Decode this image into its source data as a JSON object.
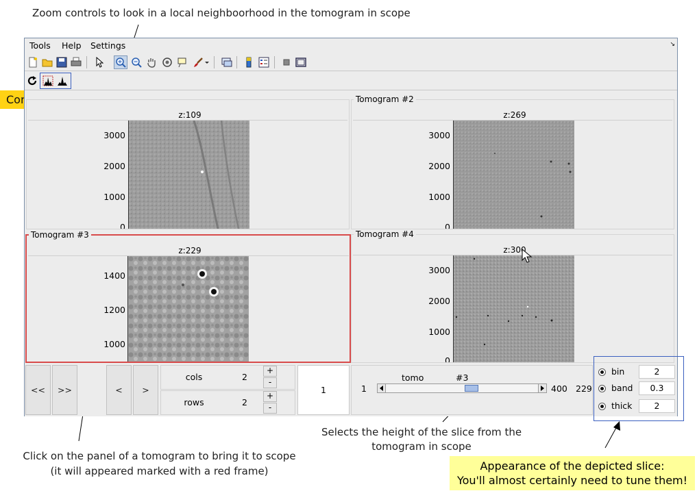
{
  "annotations": {
    "zoom_note": "Zoom controls to look in a local neighboorhood in  the tomogram in scope",
    "contrast_note": "Contrast controls",
    "panel_note_line1": "Click on the panel of a tomogram to bring it to scope",
    "panel_note_line2": "(it will appeared marked with a red frame)",
    "slice_note_line1": "Selects the height of the slice from the",
    "slice_note_line2": "tomogram in scope",
    "appearance_note_line1": "Appearance of the depicted slice:",
    "appearance_note_line2": "You'll almost certainly need to tune them!"
  },
  "menu": {
    "tools": "Tools",
    "help": "Help",
    "settings": "Settings"
  },
  "toolbar_icons": [
    "new-file-icon",
    "open-folder-icon",
    "save-icon",
    "print-icon",
    "pointer-icon",
    "zoom-in-icon",
    "zoom-out-icon",
    "pan-hand-icon",
    "rotate-3d-icon",
    "data-cursor-icon",
    "brush-icon",
    "dropdown-arrow-icon",
    "link-plot-icon",
    "colorbar-icon",
    "legend-icon",
    "hide-plot-tools-icon",
    "show-plot-tools-icon"
  ],
  "contrast_icons": [
    "refresh-icon",
    "contrast-auto-icon",
    "contrast-histogram-icon"
  ],
  "panels": [
    {
      "title": "",
      "z_label": "z:109",
      "ticks": [
        "3000",
        "2000",
        "1000",
        "0"
      ]
    },
    {
      "title": "Tomogram #2",
      "z_label": "z:269",
      "ticks": [
        "3000",
        "2000",
        "1000",
        "0"
      ]
    },
    {
      "title": "Tomogram #3",
      "z_label": "z:229",
      "ticks": [
        "1400",
        "1200",
        "1000"
      ],
      "selected": true
    },
    {
      "title": "Tomogram #4",
      "z_label": "z:300",
      "ticks": [
        "3000",
        "2000",
        "1000",
        "0"
      ]
    }
  ],
  "controls": {
    "first_label": "<<",
    "next_page_label": ">>",
    "prev_label": "<",
    "next_label": ">",
    "cols_label": "cols",
    "cols_value": "2",
    "rows_label": "rows",
    "rows_value": "2",
    "plus_label": "+",
    "minus_label": "-",
    "page_value": "1"
  },
  "slice": {
    "tomo_label": "tomo",
    "tomo_value": "#3",
    "min": "1",
    "max": "400",
    "current": "229",
    "position_fraction": 0.57
  },
  "appearance": {
    "bin_label": "bin",
    "bin_value": "2",
    "band_label": "band",
    "band_value": "0.3",
    "thick_label": "thick",
    "thick_value": "2"
  }
}
